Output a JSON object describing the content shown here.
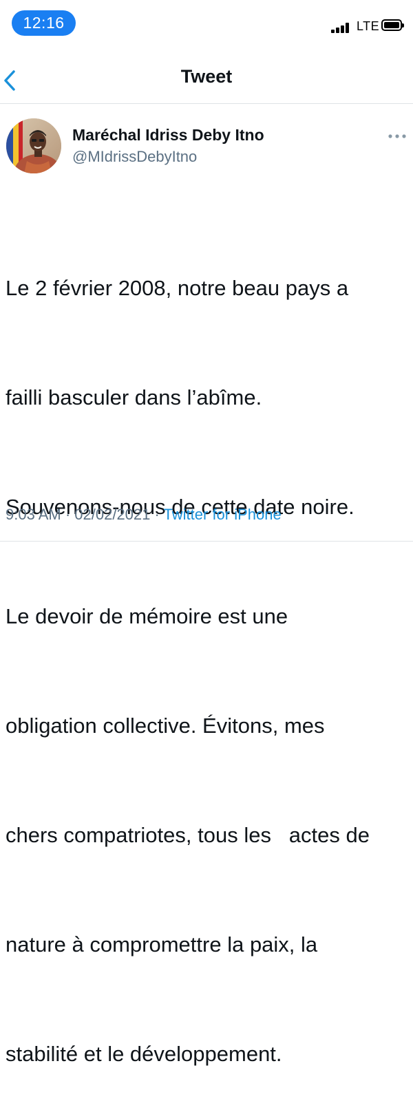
{
  "status_bar": {
    "time": "12:16",
    "network": "LTE",
    "signal_icon": "cellular-signal-icon",
    "battery_icon": "battery-full-icon"
  },
  "nav": {
    "back_icon": "chevron-left-icon",
    "title": "Tweet",
    "accent_color": "#1a91da"
  },
  "tweet": {
    "author": {
      "name": "Maréchal Idriss Deby Itno",
      "handle": "@MIdrissDebyItno",
      "avatar_icon": "profile-avatar"
    },
    "more_icon": "more-options-icon",
    "text_lines": [
      "Le 2 février 2008, notre beau pays a",
      "failli basculer dans l’abîme.",
      "Souvenons-nous de cette date noire.",
      "Le devoir de mémoire est une",
      "obligation collective. Évitons, mes",
      "chers compatriotes, tous les   actes de",
      "nature à compromettre la paix, la",
      "stabilité et le développement."
    ],
    "time": "9:03 AM",
    "date": "02/02/2021",
    "separator": " · ",
    "source": "Twitter for iPhone"
  }
}
